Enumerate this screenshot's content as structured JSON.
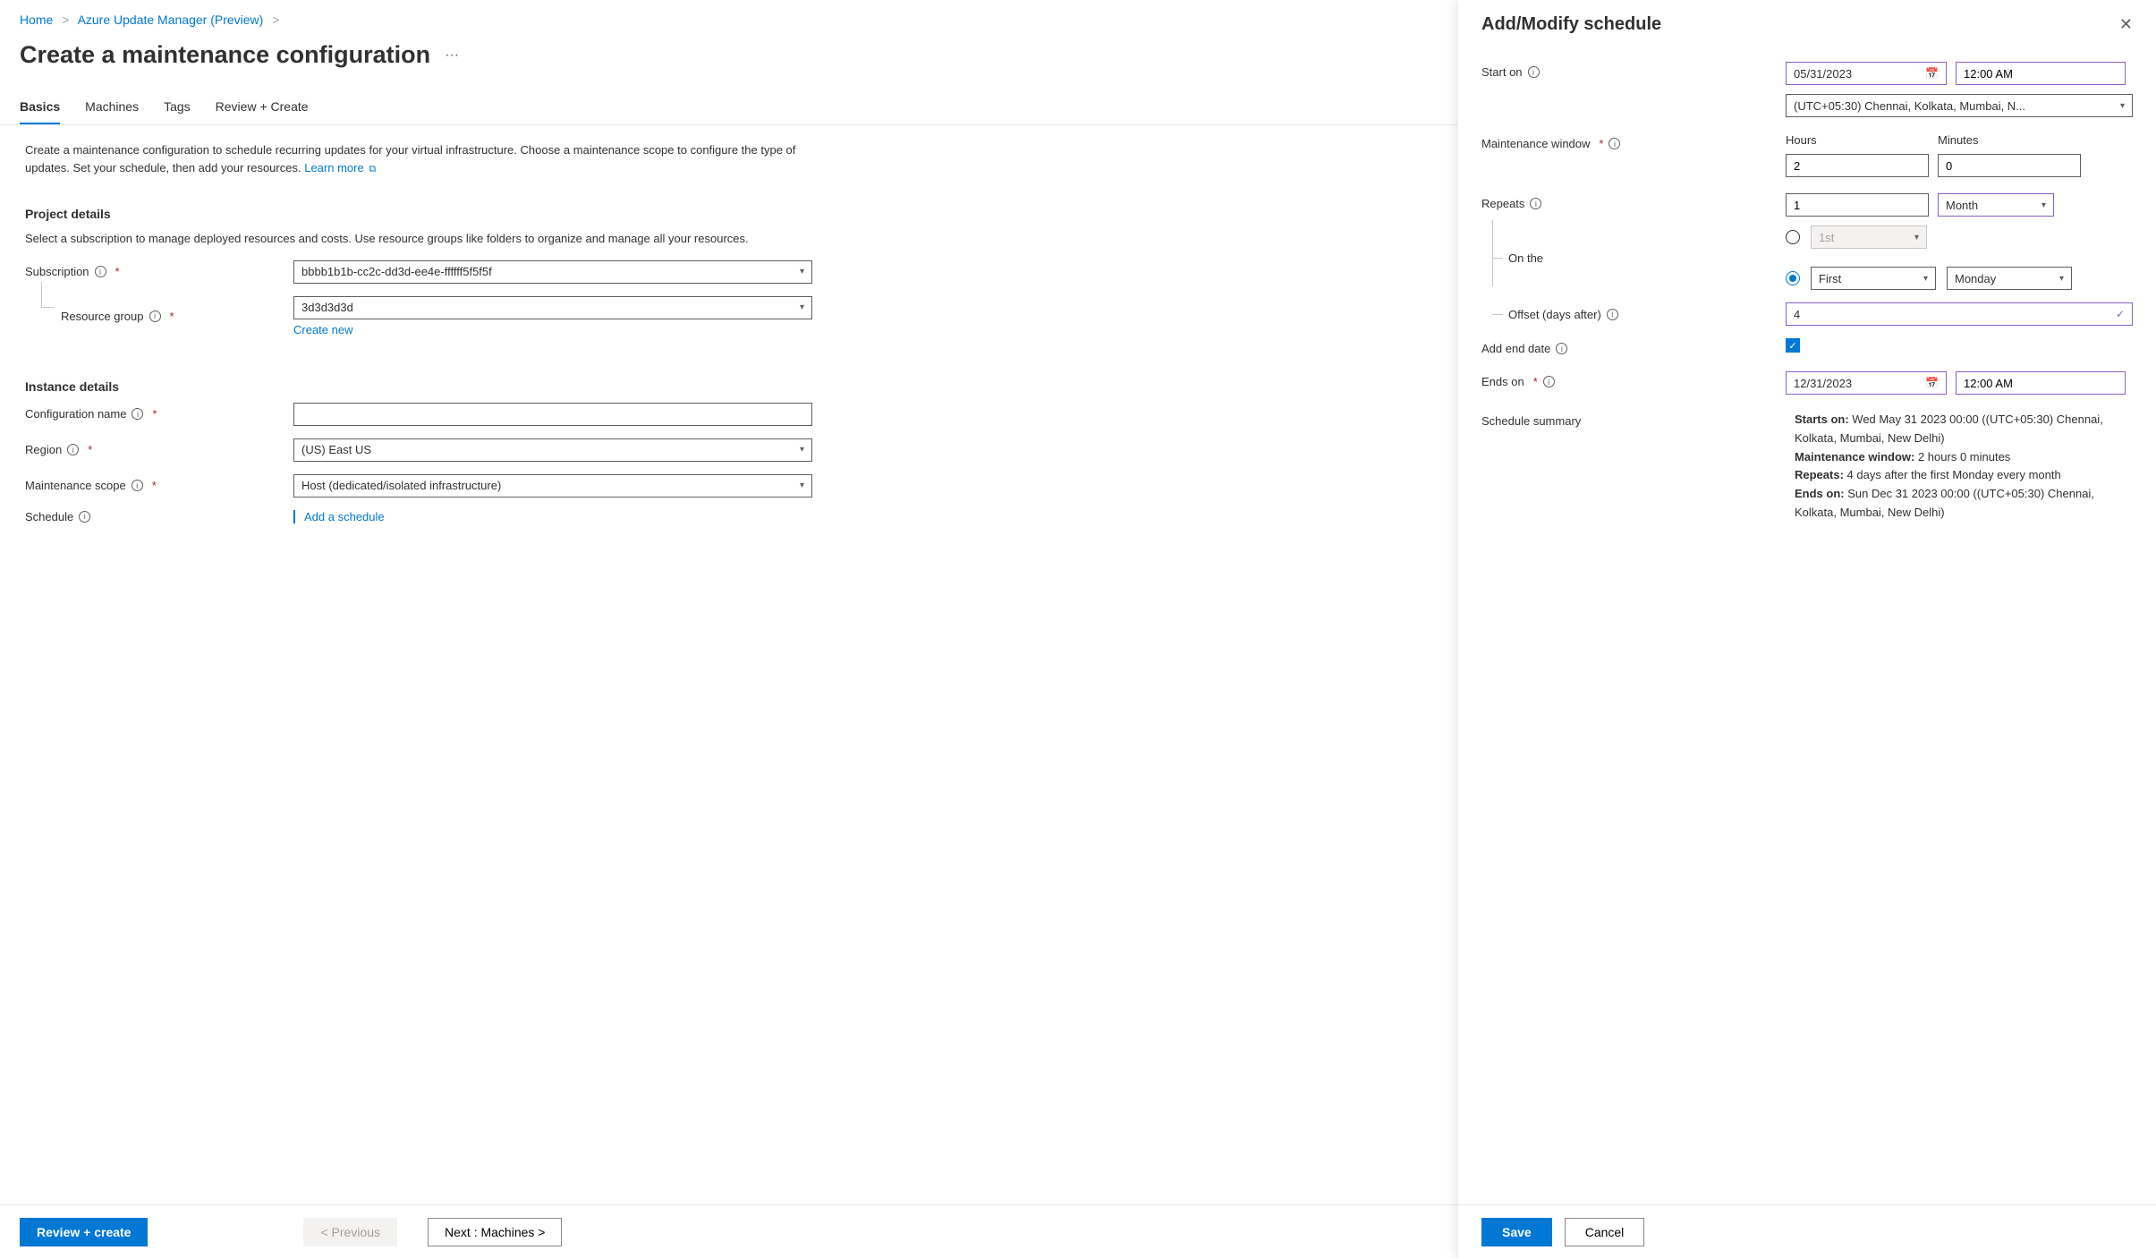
{
  "breadcrumbs": {
    "home": "Home",
    "parent": "Azure Update Manager (Preview)"
  },
  "page_title": "Create a maintenance configuration",
  "tabs": {
    "basics": "Basics",
    "machines": "Machines",
    "tags": "Tags",
    "review": "Review + Create"
  },
  "desc": {
    "text": "Create a maintenance configuration to schedule recurring updates for your virtual infrastructure. Choose a maintenance scope to configure the type of updates. Set your schedule, then add your resources.",
    "learn_more": "Learn more"
  },
  "project_details": {
    "heading": "Project details",
    "desc": "Select a subscription to manage deployed resources and costs. Use resource groups like folders to organize and manage all your resources.",
    "subscription_label": "Subscription",
    "subscription_value": "bbbb1b1b-cc2c-dd3d-ee4e-ffffff5f5f5f",
    "resource_group_label": "Resource group",
    "resource_group_value": "3d3d3d3d",
    "create_new": "Create new"
  },
  "instance_details": {
    "heading": "Instance details",
    "config_name_label": "Configuration name",
    "config_name_value": "",
    "region_label": "Region",
    "region_value": "(US) East US",
    "scope_label": "Maintenance scope",
    "scope_value": "Host (dedicated/isolated infrastructure)",
    "schedule_label": "Schedule",
    "add_schedule": "Add a schedule"
  },
  "footer": {
    "review": "Review + create",
    "previous": "< Previous",
    "next": "Next : Machines >"
  },
  "panel": {
    "title": "Add/Modify schedule",
    "start_on_label": "Start on",
    "start_date": "05/31/2023",
    "start_time": "12:00 AM",
    "timezone": "(UTC+05:30) Chennai, Kolkata, Mumbai, N...",
    "maint_window_label": "Maintenance window",
    "hours_label": "Hours",
    "minutes_label": "Minutes",
    "hours_value": "2",
    "minutes_value": "0",
    "repeats_label": "Repeats",
    "repeats_value": "1",
    "repeats_unit": "Month",
    "on_the_label": "On the",
    "radio1_value": "1st",
    "radio2_ordinal": "First",
    "radio2_day": "Monday",
    "offset_label": "Offset (days after)",
    "offset_value": "4",
    "add_end_label": "Add end date",
    "ends_on_label": "Ends on",
    "ends_date": "12/31/2023",
    "ends_time": "12:00 AM",
    "summary_label": "Schedule summary",
    "summary": {
      "starts_label": "Starts on:",
      "starts_val": "Wed May 31 2023 00:00 ((UTC+05:30) Chennai, Kolkata, Mumbai, New Delhi)",
      "window_label": "Maintenance window:",
      "window_val": "2 hours 0 minutes",
      "repeats_label": "Repeats:",
      "repeats_val": "4 days after the first Monday every month",
      "ends_label": "Ends on:",
      "ends_val": "Sun Dec 31 2023 00:00 ((UTC+05:30) Chennai, Kolkata, Mumbai, New Delhi)"
    },
    "save": "Save",
    "cancel": "Cancel"
  }
}
